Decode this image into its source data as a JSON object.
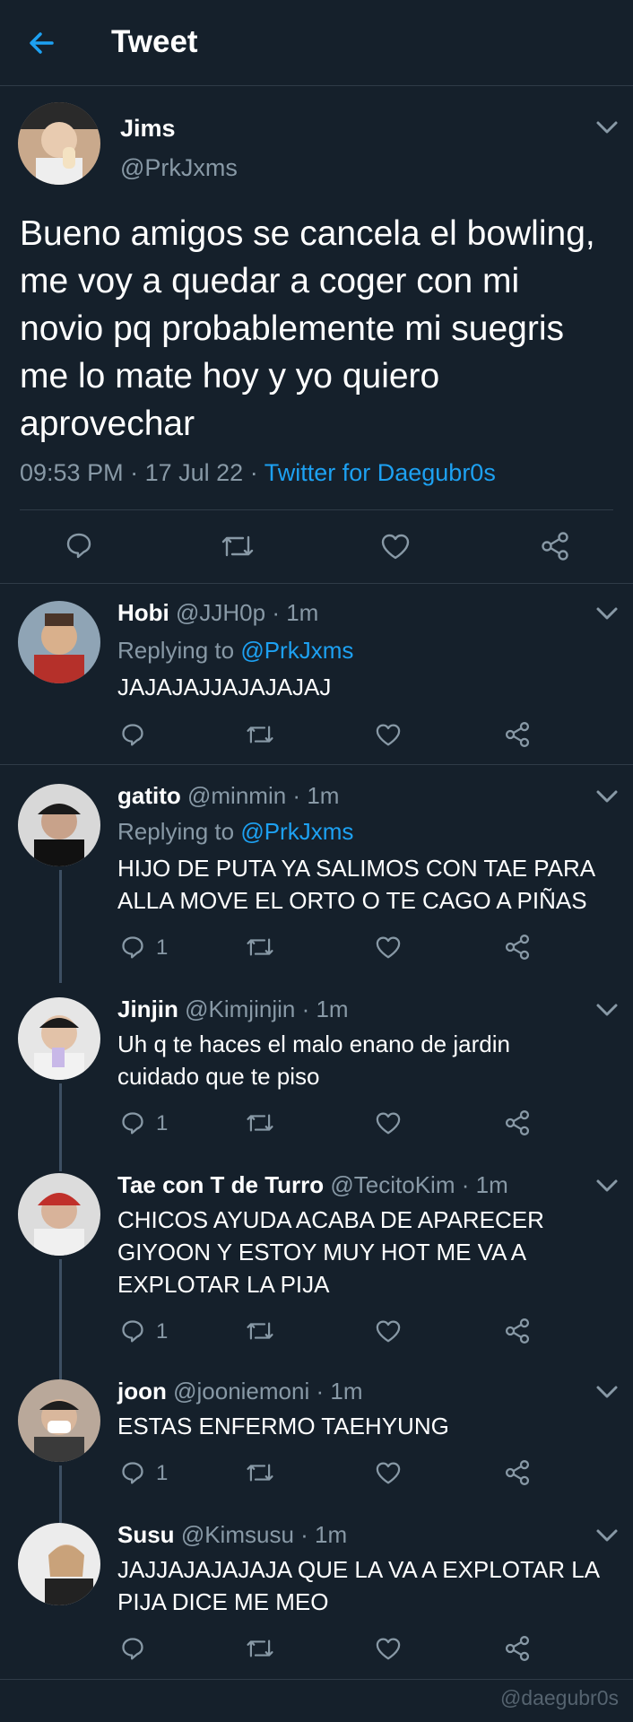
{
  "header": {
    "title": "Tweet",
    "back_icon": "arrow-left-icon"
  },
  "colors": {
    "background": "#15202b",
    "accent": "#1da1f2",
    "muted": "#8899a6",
    "divider": "#2f3b47"
  },
  "main_tweet": {
    "name": "Jims",
    "handle": "@PrkJxms",
    "text": "Bueno amigos se cancela el bowling, me voy a quedar a coger con mi novio pq probablemente mi suegris me lo mate hoy y yo quiero aprovechar",
    "time": "09:53 PM",
    "date": "17 Jul 22",
    "source": "Twitter for Daegubr0s"
  },
  "replies": [
    {
      "name": "Hobi",
      "handle": "@JJH0p",
      "time": "1m",
      "replying_label": "Replying to",
      "replying_to": "@PrkJxms",
      "text": "JAJAJAJJAJAJAJAJ",
      "reply_count": ""
    },
    {
      "name": "gatito",
      "handle": "@minmin",
      "time": "1m",
      "replying_label": "Replying to",
      "replying_to": "@PrkJxms",
      "text": "HIJO DE PUTA YA SALIMOS CON TAE PARA ALLA MOVE EL ORTO O TE CAGO A PIÑAS",
      "reply_count": "1"
    },
    {
      "name": "Jinjin",
      "handle": "@Kimjinjin",
      "time": "1m",
      "text": "Uh q te haces el malo enano de jardin cuidado que te piso",
      "reply_count": "1"
    },
    {
      "name": "Tae con T de Turro",
      "handle": "@TecitoKim",
      "time": "1m",
      "text": "CHICOS AYUDA ACABA DE APARECER GIYOON Y ESTOY MUY HOT ME VA A EXPLOTAR LA PIJA",
      "reply_count": "1"
    },
    {
      "name": "joon",
      "handle": "@jooniemoni",
      "time": "1m",
      "text": "ESTAS ENFERMO TAEHYUNG",
      "reply_count": "1"
    },
    {
      "name": "Susu",
      "handle": "@Kimsusu",
      "time": "1m",
      "text": "JAJJAJAJAJAJA QUE LA VA A EXPLOTAR LA PIJA DICE ME MEO",
      "reply_count": ""
    }
  ],
  "watermark": "@daegubr0s"
}
